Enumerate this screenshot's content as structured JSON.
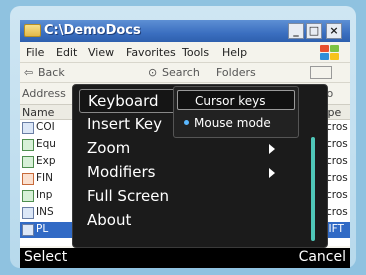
{
  "window": {
    "title": "C:\\DemoDocs",
    "minimize": "_",
    "maximize": "□",
    "close": "×"
  },
  "menubar": [
    "File",
    "Edit",
    "View",
    "Favorites",
    "Tools",
    "Help"
  ],
  "toolbar": {
    "back": "Back",
    "search": "Search",
    "folders": "Folders"
  },
  "address": {
    "label": "Address",
    "go": "Go"
  },
  "list": {
    "col_name": "Name",
    "col_type": "Type",
    "rows": [
      {
        "name": "COI",
        "type": "Microsof",
        "icon": "word-doc-icon"
      },
      {
        "name": "Equ",
        "type": "Microsof",
        "icon": "excel-doc-icon"
      },
      {
        "name": "Exp",
        "type": "Microsof",
        "icon": "excel-doc-icon"
      },
      {
        "name": "FIN",
        "type": "Microsof",
        "icon": "ppt-doc-icon"
      },
      {
        "name": "Inp",
        "type": "Microsof",
        "icon": "excel-doc-icon"
      },
      {
        "name": "INS",
        "type": "Microsof",
        "icon": "word-doc-icon"
      },
      {
        "name": "PL",
        "type": "SHIFT",
        "icon": "file-icon"
      }
    ]
  },
  "popup_menu": {
    "items": [
      {
        "label": "Keyboard",
        "has_submenu": false,
        "selected": true
      },
      {
        "label": "Insert Key",
        "has_submenu": false
      },
      {
        "label": "Zoom",
        "has_submenu": true
      },
      {
        "label": "Modifiers",
        "has_submenu": true
      },
      {
        "label": "Full Screen",
        "has_submenu": false
      },
      {
        "label": "About",
        "has_submenu": false
      }
    ]
  },
  "submenu": {
    "items": [
      {
        "label": "Cursor keys",
        "checked": false
      },
      {
        "label": "Mouse mode",
        "checked": true
      }
    ]
  },
  "softkeys": {
    "left": "Select",
    "right": "Cancel"
  },
  "colors": {
    "accent": "#4fc6b8",
    "titlebar": "#3b6fc0",
    "popup_bg": "#1b1b1b"
  }
}
